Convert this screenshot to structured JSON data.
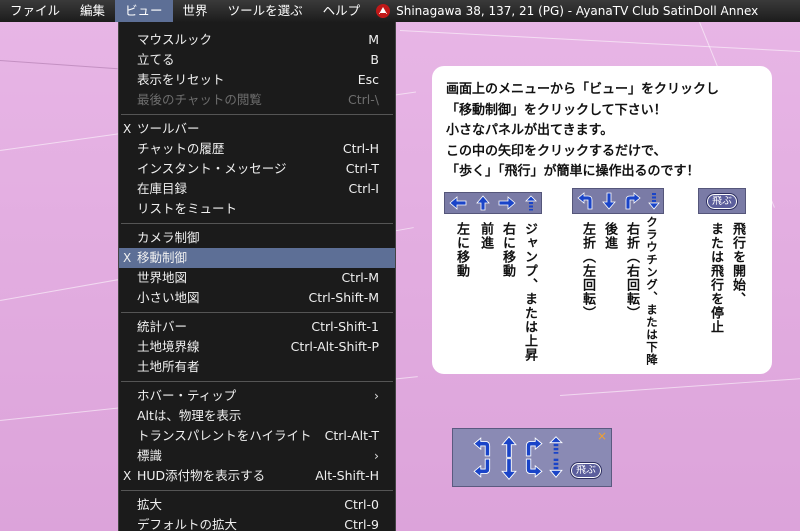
{
  "menubar": {
    "items": [
      "ファイル",
      "編集",
      "ビュー",
      "世界",
      "ツールを選ぶ",
      "ヘルプ"
    ],
    "status": "Shinagawa 38, 137, 21 (PG) - AyanaTV Club SatinDoll Annex"
  },
  "view_menu": {
    "items": [
      {
        "label": "マウスルック",
        "shortcut": "M"
      },
      {
        "label": "立てる",
        "shortcut": "B"
      },
      {
        "label": "表示をリセット",
        "shortcut": "Esc"
      },
      {
        "label": "最後のチャットの閲覧",
        "shortcut": "Ctrl-\\",
        "disabled": true
      },
      {
        "separator": true
      },
      {
        "label": "ツールバー",
        "checked": "X"
      },
      {
        "label": "チャットの履歴",
        "shortcut": "Ctrl-H"
      },
      {
        "label": "インスタント・メッセージ",
        "shortcut": "Ctrl-T"
      },
      {
        "label": "在庫目録",
        "shortcut": "Ctrl-I"
      },
      {
        "label": "リストをミュート"
      },
      {
        "separator": true
      },
      {
        "label": "カメラ制御"
      },
      {
        "label": "移動制御",
        "checked": "X",
        "selected": true
      },
      {
        "label": "世界地図",
        "shortcut": "Ctrl-M"
      },
      {
        "label": "小さい地図",
        "shortcut": "Ctrl-Shift-M"
      },
      {
        "separator": true
      },
      {
        "label": "統計バー",
        "shortcut": "Ctrl-Shift-1"
      },
      {
        "label": "土地境界線",
        "shortcut": "Ctrl-Alt-Shift-P"
      },
      {
        "label": "土地所有者"
      },
      {
        "separator": true
      },
      {
        "label": "ホバー・ティップ",
        "submenu": "›"
      },
      {
        "label": "Altは、物理を表示"
      },
      {
        "label": "トランスパレントをハイライト",
        "shortcut": "Ctrl-Alt-T"
      },
      {
        "label": "標識",
        "submenu": "›"
      },
      {
        "label": "HUD添付物を表示する",
        "shortcut": "Alt-Shift-H",
        "checked": "X"
      },
      {
        "separator": true
      },
      {
        "label": "拡大",
        "shortcut": "Ctrl-0"
      },
      {
        "label": "デフォルトの拡大",
        "shortcut": "Ctrl-9"
      }
    ]
  },
  "info_panel": {
    "lines": [
      "画面上のメニューから「ビュー」をクリックし",
      "「移動制御」をクリックして下さい！",
      "小さなパネルが出てきます。",
      "この中の矢印をクリックするだけで、",
      "「歩く」「飛行」が簡単に操作出るのです！"
    ],
    "fly_button": "飛ぶ",
    "columns": [
      "左に移動",
      "前進",
      "右に移動",
      "ジャンプ、または上昇",
      "左折（左回転）",
      "後進",
      "右折（右回転）",
      "クラウチング、または下降",
      "飛行を開始、",
      "または飛行を停止"
    ]
  },
  "move_panel": {
    "fly_button": "飛ぶ",
    "close": "×"
  },
  "colors": {
    "menu_bg": "#1b1b1b",
    "highlight": "#5d6f96",
    "panel_bg": "#8a8ab4",
    "arrow_blue": "#1a44c8",
    "ground": "#dca3da"
  }
}
